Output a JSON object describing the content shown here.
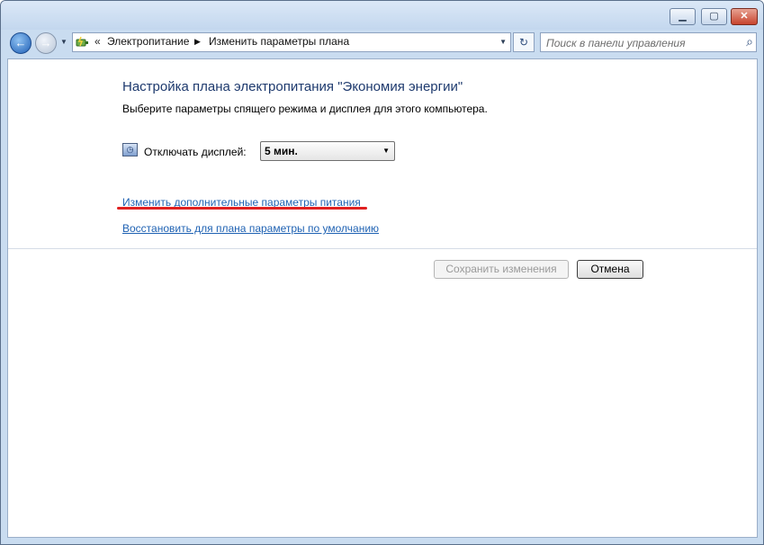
{
  "window": {
    "minimize_glyph": "▁",
    "maximize_glyph": "▢",
    "close_glyph": "✕"
  },
  "nav": {
    "back_glyph": "←",
    "forward_glyph": "→",
    "history_glyph": "▼",
    "address_icon": "power-options-icon",
    "more_glyph": "«",
    "breadcrumb": [
      "Электропитание",
      "Изменить параметры плана"
    ],
    "breadcrumb_sep": "▶",
    "dropdown_glyph": "▼",
    "refresh_glyph": "↻",
    "search_placeholder": "Поиск в панели управления",
    "search_glyph": "⌕"
  },
  "main": {
    "title": "Настройка плана электропитания \"Экономия энергии\"",
    "subtitle": "Выберите параметры спящего режима и дисплея для этого компьютера.",
    "display_icon_glyph": "◷",
    "display_label": "Отключать дисплей:",
    "display_value": "5 мин.",
    "select_arrow": "▼",
    "link_advanced": "Изменить дополнительные параметры питания",
    "link_restore": "Восстановить для плана параметры по умолчанию",
    "highlight_color": "#e02020",
    "save_label": "Сохранить изменения",
    "save_enabled": false,
    "cancel_label": "Отмена"
  }
}
